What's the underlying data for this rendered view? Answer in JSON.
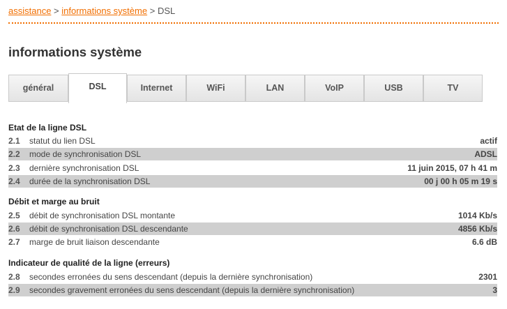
{
  "breadcrumb": {
    "link1": "assistance",
    "sep1": ">",
    "link2": "informations système",
    "sep2": ">",
    "current": "DSL"
  },
  "page_title": "informations système",
  "tabs": [
    "général",
    "DSL",
    "Internet",
    "WiFi",
    "LAN",
    "VoIP",
    "USB",
    "TV"
  ],
  "active_tab": "DSL",
  "accent_color": "#f16e00",
  "sections": [
    {
      "title": "Etat de la ligne DSL",
      "rows": [
        {
          "num": "2.1",
          "label": "statut du lien DSL",
          "value": "actif"
        },
        {
          "num": "2.2",
          "label": "mode de synchronisation DSL",
          "value": "ADSL"
        },
        {
          "num": "2.3",
          "label": "dernière synchronisation DSL",
          "value": "11 juin 2015, 07 h 41 m"
        },
        {
          "num": "2.4",
          "label": "durée de la synchronisation DSL",
          "value": "00 j 00 h 05 m 19 s"
        }
      ]
    },
    {
      "title": "Débit et marge au bruit",
      "rows": [
        {
          "num": "2.5",
          "label": "débit de synchronisation DSL montante",
          "value": "1014 Kb/s"
        },
        {
          "num": "2.6",
          "label": "débit de synchronisation DSL descendante",
          "value": "4856 Kb/s"
        },
        {
          "num": "2.7",
          "label": "marge de bruit liaison descendante",
          "value": "6.6 dB"
        }
      ]
    },
    {
      "title": "Indicateur de qualité de la ligne (erreurs)",
      "rows": [
        {
          "num": "2.8",
          "label": "secondes erronées du sens descendant (depuis la dernière synchronisation)",
          "value": "2301"
        },
        {
          "num": "2.9",
          "label": "secondes gravement erronées du sens descendant (depuis la dernière synchronisation)",
          "value": "3"
        }
      ]
    }
  ]
}
